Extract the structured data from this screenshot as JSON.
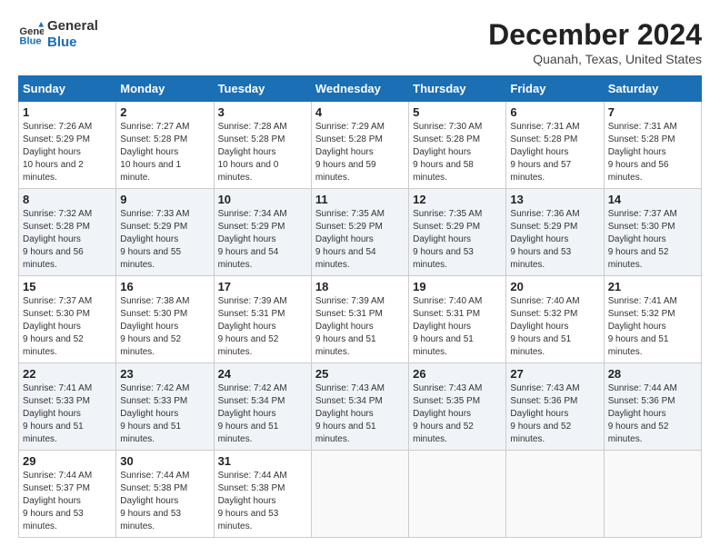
{
  "header": {
    "logo_line1": "General",
    "logo_line2": "Blue",
    "month": "December 2024",
    "location": "Quanah, Texas, United States"
  },
  "weekdays": [
    "Sunday",
    "Monday",
    "Tuesday",
    "Wednesday",
    "Thursday",
    "Friday",
    "Saturday"
  ],
  "weeks": [
    [
      {
        "day": 1,
        "sunrise": "7:26 AM",
        "sunset": "5:29 PM",
        "daylight": "10 hours and 2 minutes."
      },
      {
        "day": 2,
        "sunrise": "7:27 AM",
        "sunset": "5:28 PM",
        "daylight": "10 hours and 1 minute."
      },
      {
        "day": 3,
        "sunrise": "7:28 AM",
        "sunset": "5:28 PM",
        "daylight": "10 hours and 0 minutes."
      },
      {
        "day": 4,
        "sunrise": "7:29 AM",
        "sunset": "5:28 PM",
        "daylight": "9 hours and 59 minutes."
      },
      {
        "day": 5,
        "sunrise": "7:30 AM",
        "sunset": "5:28 PM",
        "daylight": "9 hours and 58 minutes."
      },
      {
        "day": 6,
        "sunrise": "7:31 AM",
        "sunset": "5:28 PM",
        "daylight": "9 hours and 57 minutes."
      },
      {
        "day": 7,
        "sunrise": "7:31 AM",
        "sunset": "5:28 PM",
        "daylight": "9 hours and 56 minutes."
      }
    ],
    [
      {
        "day": 8,
        "sunrise": "7:32 AM",
        "sunset": "5:28 PM",
        "daylight": "9 hours and 56 minutes."
      },
      {
        "day": 9,
        "sunrise": "7:33 AM",
        "sunset": "5:29 PM",
        "daylight": "9 hours and 55 minutes."
      },
      {
        "day": 10,
        "sunrise": "7:34 AM",
        "sunset": "5:29 PM",
        "daylight": "9 hours and 54 minutes."
      },
      {
        "day": 11,
        "sunrise": "7:35 AM",
        "sunset": "5:29 PM",
        "daylight": "9 hours and 54 minutes."
      },
      {
        "day": 12,
        "sunrise": "7:35 AM",
        "sunset": "5:29 PM",
        "daylight": "9 hours and 53 minutes."
      },
      {
        "day": 13,
        "sunrise": "7:36 AM",
        "sunset": "5:29 PM",
        "daylight": "9 hours and 53 minutes."
      },
      {
        "day": 14,
        "sunrise": "7:37 AM",
        "sunset": "5:30 PM",
        "daylight": "9 hours and 52 minutes."
      }
    ],
    [
      {
        "day": 15,
        "sunrise": "7:37 AM",
        "sunset": "5:30 PM",
        "daylight": "9 hours and 52 minutes."
      },
      {
        "day": 16,
        "sunrise": "7:38 AM",
        "sunset": "5:30 PM",
        "daylight": "9 hours and 52 minutes."
      },
      {
        "day": 17,
        "sunrise": "7:39 AM",
        "sunset": "5:31 PM",
        "daylight": "9 hours and 52 minutes."
      },
      {
        "day": 18,
        "sunrise": "7:39 AM",
        "sunset": "5:31 PM",
        "daylight": "9 hours and 51 minutes."
      },
      {
        "day": 19,
        "sunrise": "7:40 AM",
        "sunset": "5:31 PM",
        "daylight": "9 hours and 51 minutes."
      },
      {
        "day": 20,
        "sunrise": "7:40 AM",
        "sunset": "5:32 PM",
        "daylight": "9 hours and 51 minutes."
      },
      {
        "day": 21,
        "sunrise": "7:41 AM",
        "sunset": "5:32 PM",
        "daylight": "9 hours and 51 minutes."
      }
    ],
    [
      {
        "day": 22,
        "sunrise": "7:41 AM",
        "sunset": "5:33 PM",
        "daylight": "9 hours and 51 minutes."
      },
      {
        "day": 23,
        "sunrise": "7:42 AM",
        "sunset": "5:33 PM",
        "daylight": "9 hours and 51 minutes."
      },
      {
        "day": 24,
        "sunrise": "7:42 AM",
        "sunset": "5:34 PM",
        "daylight": "9 hours and 51 minutes."
      },
      {
        "day": 25,
        "sunrise": "7:43 AM",
        "sunset": "5:34 PM",
        "daylight": "9 hours and 51 minutes."
      },
      {
        "day": 26,
        "sunrise": "7:43 AM",
        "sunset": "5:35 PM",
        "daylight": "9 hours and 52 minutes."
      },
      {
        "day": 27,
        "sunrise": "7:43 AM",
        "sunset": "5:36 PM",
        "daylight": "9 hours and 52 minutes."
      },
      {
        "day": 28,
        "sunrise": "7:44 AM",
        "sunset": "5:36 PM",
        "daylight": "9 hours and 52 minutes."
      }
    ],
    [
      {
        "day": 29,
        "sunrise": "7:44 AM",
        "sunset": "5:37 PM",
        "daylight": "9 hours and 53 minutes."
      },
      {
        "day": 30,
        "sunrise": "7:44 AM",
        "sunset": "5:38 PM",
        "daylight": "9 hours and 53 minutes."
      },
      {
        "day": 31,
        "sunrise": "7:44 AM",
        "sunset": "5:38 PM",
        "daylight": "9 hours and 53 minutes."
      },
      null,
      null,
      null,
      null
    ]
  ]
}
